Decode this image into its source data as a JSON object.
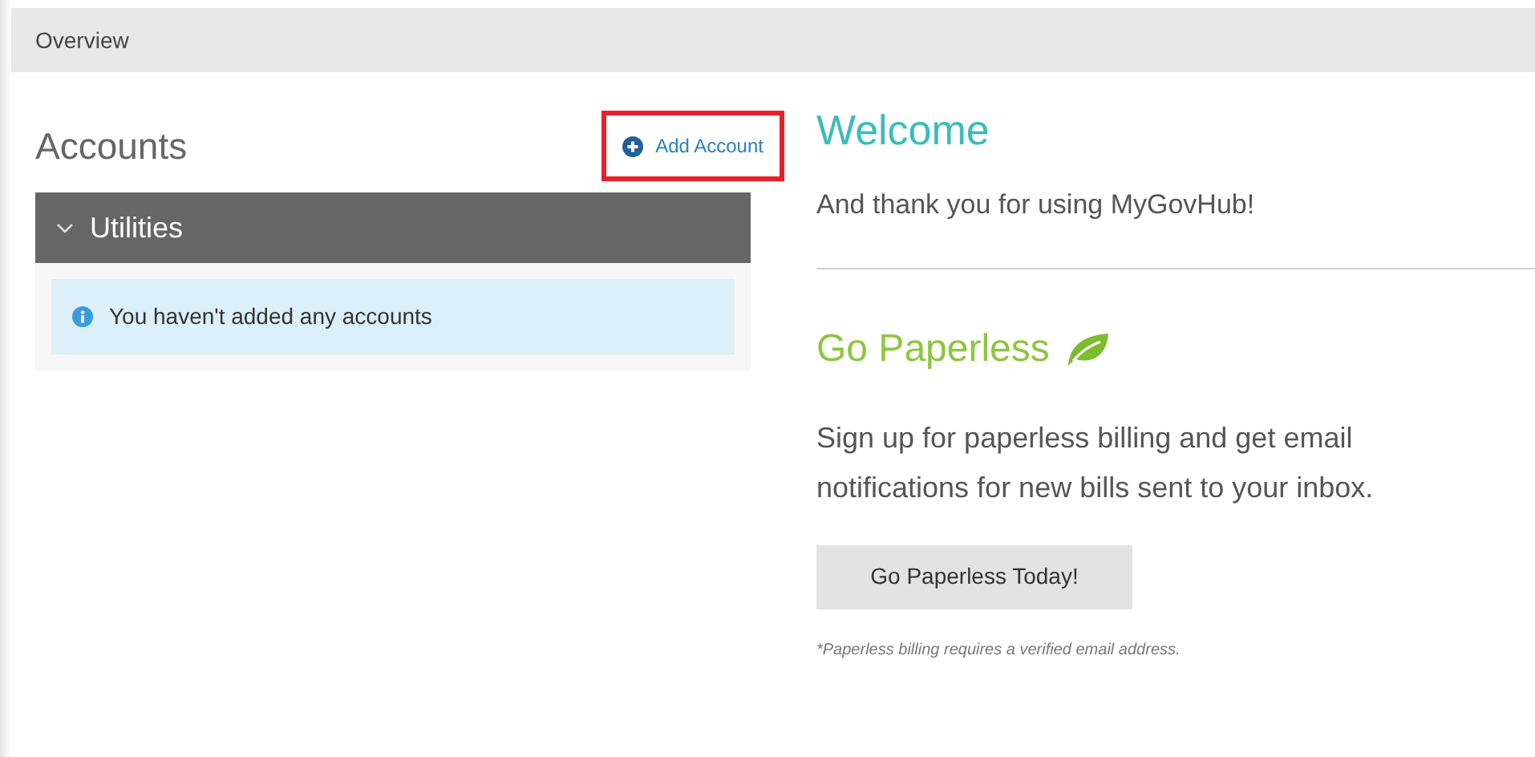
{
  "header": {
    "title": "Overview"
  },
  "accounts": {
    "title": "Accounts",
    "add_button": {
      "label": "Add Account",
      "highlighted": true
    },
    "groups": [
      {
        "name": "Utilities",
        "expanded": true,
        "message": "You haven't added any accounts"
      }
    ]
  },
  "welcome": {
    "title": "Welcome",
    "text": "And thank you for using MyGovHub!"
  },
  "paperless": {
    "title": "Go Paperless",
    "text": "Sign up for paperless billing and get email notifications for new bills sent to your inbox.",
    "button": "Go Paperless Today!",
    "footnote": "*Paperless billing requires a verified email address."
  }
}
